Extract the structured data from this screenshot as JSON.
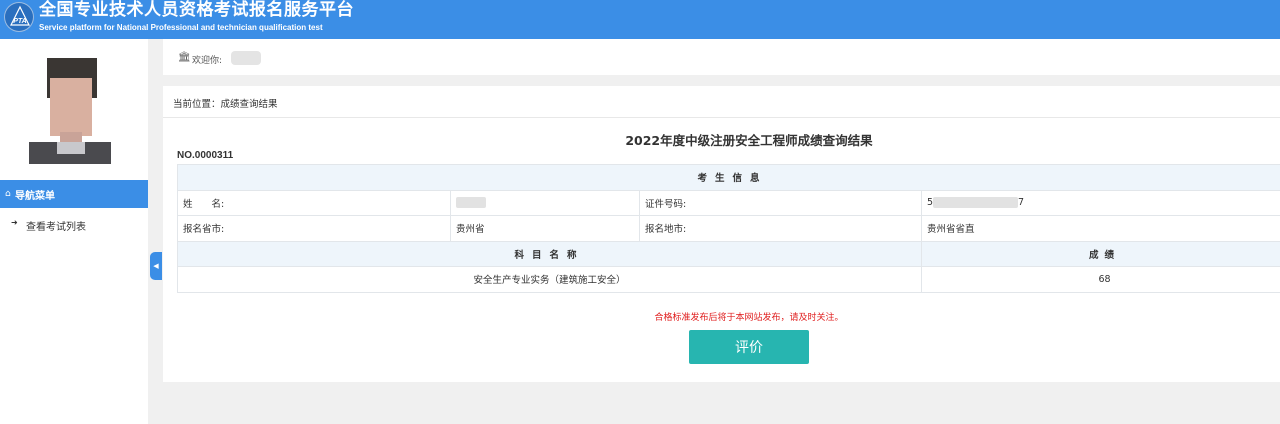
{
  "header": {
    "title": "全国专业技术人员资格考试报名服务平台",
    "subtitle": "Service platform for National Professional and technician qualification test",
    "logo_text": "PTA",
    "bg_color": "#3b8ee6"
  },
  "sidebar": {
    "nav_menu_label": "导航菜单",
    "nav_menu_icon": "home-icon",
    "items": [
      {
        "label": "查看考试列表",
        "icon": "sign-in-icon"
      }
    ],
    "collapse_icon": "chevron-left-icon"
  },
  "welcome": {
    "label": "欢迎你:",
    "icon": "bank-icon"
  },
  "breadcrumb": "当前位置：成绩查询结果",
  "result": {
    "title": "2022年度中级注册安全工程师成绩查询结果",
    "serial": "NO.0000311",
    "section_header": "考生信息",
    "name_label": "姓　　名:",
    "name_value_visible": "",
    "id_label": "证件号码:",
    "id_value_prefix": "5",
    "id_value_suffix": "7",
    "province_label": "报名省市:",
    "province_value": "贵州省",
    "city_label": "报名地市:",
    "city_value": "贵州省省直",
    "subject_header": "科目名称",
    "score_header": "成绩",
    "subjects": [
      {
        "name": "安全生产专业实务（建筑施工安全）",
        "score": "68"
      }
    ]
  },
  "notice": "合格标准发布后将于本网站发布，请及时关注。",
  "eval_button": "评价",
  "colors": {
    "accent": "#3b8ee6",
    "button": "#27b5b0",
    "notice": "#e02020"
  }
}
